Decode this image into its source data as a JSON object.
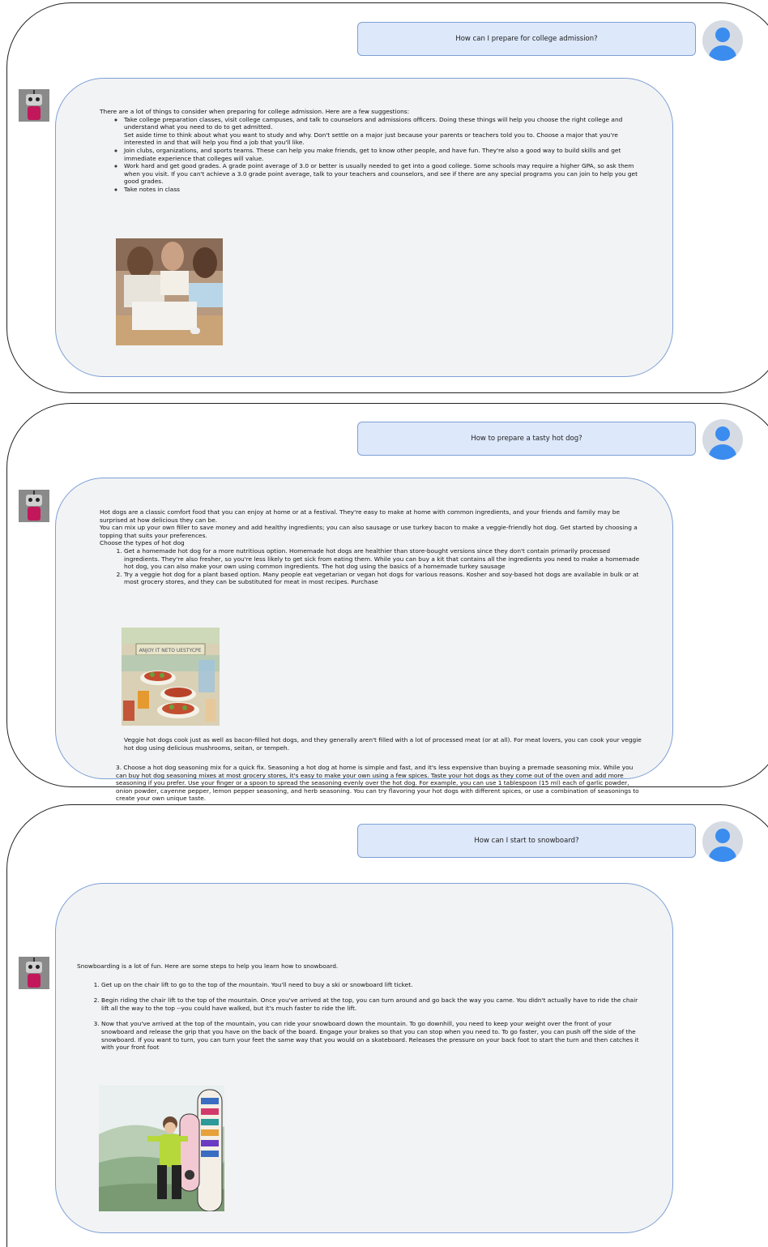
{
  "conversations": [
    {
      "question": "How can I prepare for college admission?",
      "intro": "There are a lot of things to consider when preparing for college admission. Here are a few suggestions:",
      "bullets": [
        "Take college preparation classes, visit college campuses, and talk to counselors and admissions officers. Doing these things will help you choose the right college and understand what you need to do to get admitted.",
        "Join clubs, organizations, and sports teams. These can help you make friends, get to know other people, and have fun. They're also a good way to build skills and get immediate experience that colleges will value.",
        "Work hard and get good grades. A grade point average of 3.0 or better is usually needed to get into a good college. Some schools may require a higher GPA, so ask them when you visit. If you can't achieve a 3.0 grade point average, talk to your teachers and counselors, and see if there are any special programs you can join to help you get good grades.",
        "Take notes in class"
      ],
      "bullet1_extra": "Set aside time to think about what you want to study and why. Don't settle on a major just because your parents or teachers told you to. Choose a major that you're interested in and that will help you find a job that you'll like.",
      "image_label": "students-studying-photo"
    },
    {
      "question": "How to prepare a tasty hot dog?",
      "para1": "Hot dogs are a classic comfort food that you can enjoy at home or at a festival. They're easy to make at home with common ingredients, and your friends and family may be surprised at how delicious they can be.",
      "para2": "You can mix up your own filler to save money and add healthy ingredients; you can also sausage or use turkey bacon to make a veggie-friendly hot dog. Get started by choosing a topping that suits your preferences.",
      "para3": "Choose the types of hot dog",
      "items": [
        "Get a homemade hot dog for a more nutritious option. Homemade hot dogs are healthier than store-bought versions since they don't contain primarily processed ingredients. They're also fresher, so you're less likely to get sick from eating them. While you can buy a kit that contains all the ingredients you need to make a homemade hot dog, you can also make your own using common ingredients. The hot dog using the basics of a homemade turkey sausage",
        "Try a veggie hot dog for a plant based option. Many people eat vegetarian or vegan hot dogs for various reasons. Kosher and soy-based hot dogs are available in bulk or at most grocery stores, and they can be substituted for meat in most recipes. Purchase"
      ],
      "sign_text": "ANJOY IT NETO UESTYCPE",
      "after_image": "Veggie hot dogs cook just as well as bacon-filled hot dogs, and they generally aren't filled with a lot of processed meat (or at all). For meat lovers, you can cook your veggie hot dog using delicious mushrooms, seitan, or tempeh.",
      "step3": "3. Choose a hot dog seasoning mix for a quick fix. Seasoning a hot dog at home is simple and fast, and it's less expensive than buying a premade seasoning mix. While you can buy hot dog seasoning mixes at most grocery stores, it's easy to make your own using a few spices. Taste your hot dogs as they come out of the oven and add more seasoning if you prefer. Use your finger or a spoon to spread the seasoning evenly over the hot dog. For example, you can use 1 tablespoon (15 ml) each of garlic powder, onion powder, cayenne pepper, lemon pepper seasoning, and herb seasoning. You can try flavoring your hot dogs with different spices, or use a combination of seasonings to create your own unique taste."
    },
    {
      "question": "How can I start to snowboard?",
      "intro": "Snowboarding is a lot of fun. Here are some steps to help you learn how to snowboard.",
      "steps": [
        "Get up on the chair lift to go to the top of the mountain. You'll need to buy a ski or snowboard lift ticket.",
        "Begin riding the chair lift to the top of the mountain. Once you've arrived at the top, you can turn around and go back the way you came. You didn't actually have to ride the chair lift all the way to the top --you could have walked, but it's much faster to ride the lift.",
        "Now that you've arrived at the top of the mountain, you can ride your snowboard down the mountain. To go downhill, you need to keep your weight over the front of your snowboard and release the grip that you have on the back of the board. Engage your brakes so that you can stop when you need to. To go faster, you can push off the side of the snowboard. If you want to turn, you can turn your feet the same way that you would on a skateboard. Releases the pressure on your back foot to start the turn and then catches it with your front foot"
      ]
    }
  ]
}
